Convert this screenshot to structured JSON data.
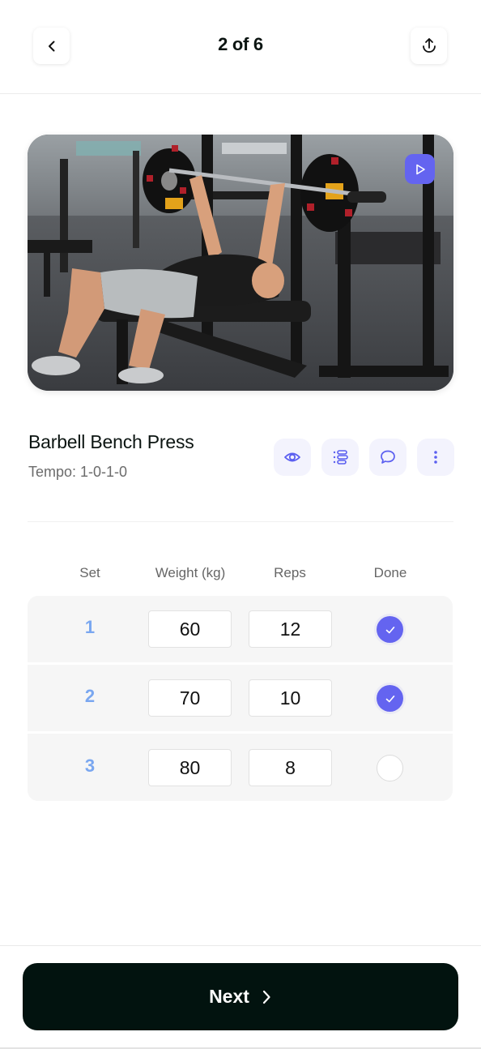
{
  "header": {
    "page_counter": "2 of 6",
    "back_icon": "chevron-left-icon",
    "share_icon": "share-upload-icon"
  },
  "media": {
    "description": "Man performing barbell bench press in a gym",
    "play_icon": "play-icon",
    "accent_color": "#6464f0"
  },
  "exercise": {
    "title": "Barbell Bench Press",
    "tempo": "Tempo: 1-0-1-0",
    "actions": [
      {
        "icon": "eye-icon",
        "name": "view"
      },
      {
        "icon": "list-icon",
        "name": "instructions"
      },
      {
        "icon": "comment-icon",
        "name": "comments"
      },
      {
        "icon": "more-vertical-icon",
        "name": "more"
      }
    ]
  },
  "table": {
    "headers": {
      "set": "Set",
      "weight": "Weight (kg)",
      "reps": "Reps",
      "done": "Done"
    },
    "rows": [
      {
        "set": "1",
        "weight": "60",
        "reps": "12",
        "done": true
      },
      {
        "set": "2",
        "weight": "70",
        "reps": "10",
        "done": true
      },
      {
        "set": "3",
        "weight": "80",
        "reps": "8",
        "done": false
      }
    ]
  },
  "footer": {
    "next_label": "Next",
    "next_icon": "chevron-right-icon"
  },
  "colors": {
    "accent": "#6464f0",
    "set_number": "#7aa7f0",
    "primary_button": "#02130f",
    "action_bg": "#f3f3fd"
  }
}
